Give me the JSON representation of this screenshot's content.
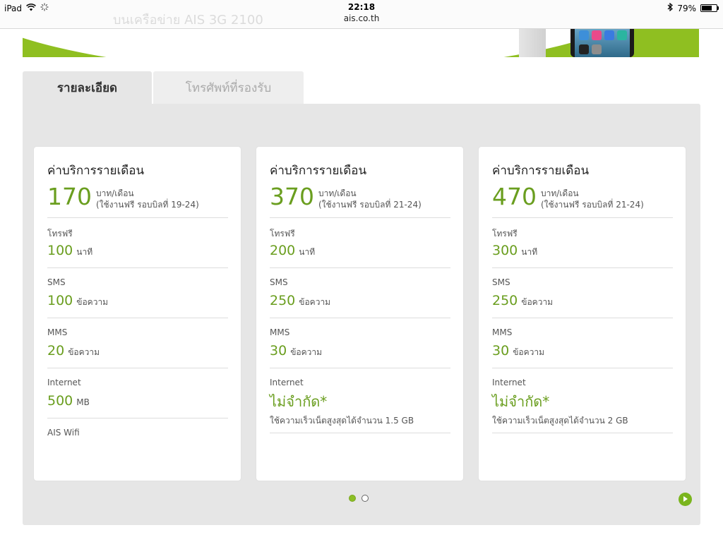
{
  "status_bar": {
    "device": "iPad",
    "time": "22:18",
    "url": "ais.co.th",
    "battery": "79%",
    "battery_level": 0.79
  },
  "banner": {
    "ghost_text": "บนเครือข่าย AIS 3G 2100"
  },
  "tabs": [
    {
      "label": "รายละเอียด",
      "active": true
    },
    {
      "label": "โทรศัพท์ที่รองรับ",
      "active": false
    }
  ],
  "cards": [
    {
      "title": "ค่าบริการรายเดือน",
      "price": "170",
      "price_unit": "บาท/เดือน",
      "price_note": "(ใช้งานฟรี รอบบิลที่ 19-24)",
      "voice_label": "โทรฟรี",
      "voice_value": "100",
      "voice_unit": "นาที",
      "sms_label": "SMS",
      "sms_value": "100",
      "sms_unit": "ข้อความ",
      "mms_label": "MMS",
      "mms_value": "20",
      "mms_unit": "ข้อความ",
      "internet_label": "Internet",
      "internet_value": "500",
      "internet_unit": "MB",
      "wifi_label": "AIS Wifi"
    },
    {
      "title": "ค่าบริการรายเดือน",
      "price": "370",
      "price_unit": "บาท/เดือน",
      "price_note": "(ใช้งานฟรี รอบบิลที่ 21-24)",
      "voice_label": "โทรฟรี",
      "voice_value": "200",
      "voice_unit": "นาที",
      "sms_label": "SMS",
      "sms_value": "250",
      "sms_unit": "ข้อความ",
      "mms_label": "MMS",
      "mms_value": "30",
      "mms_unit": "ข้อความ",
      "internet_label": "Internet",
      "internet_value": "ไม่จำกัด*",
      "internet_note": "ใช้ความเร็วเน็ตสูงสุดได้จำนวน 1.5 GB"
    },
    {
      "title": "ค่าบริการรายเดือน",
      "price": "470",
      "price_unit": "บาท/เดือน",
      "price_note": "(ใช้งานฟรี รอบบิลที่ 21-24)",
      "voice_label": "โทรฟรี",
      "voice_value": "300",
      "voice_unit": "นาที",
      "sms_label": "SMS",
      "sms_value": "250",
      "sms_unit": "ข้อความ",
      "mms_label": "MMS",
      "mms_value": "30",
      "mms_unit": "ข้อความ",
      "internet_label": "Internet",
      "internet_value": "ไม่จำกัด*",
      "internet_note": "ใช้ความเร็วเน็ตสูงสุดได้จำนวน 2 GB"
    }
  ],
  "pagination": {
    "pages": 2,
    "current": 1
  },
  "colors": {
    "accent_green": "#6a9e1f",
    "banner_green": "#8fbf21",
    "panel_gray": "#e6e6e6"
  },
  "icons": {
    "next": "play-next-icon",
    "wifi": "wifi-icon",
    "bluetooth": "bluetooth-icon",
    "battery": "battery-icon",
    "loading": "activity-spinner-icon"
  }
}
